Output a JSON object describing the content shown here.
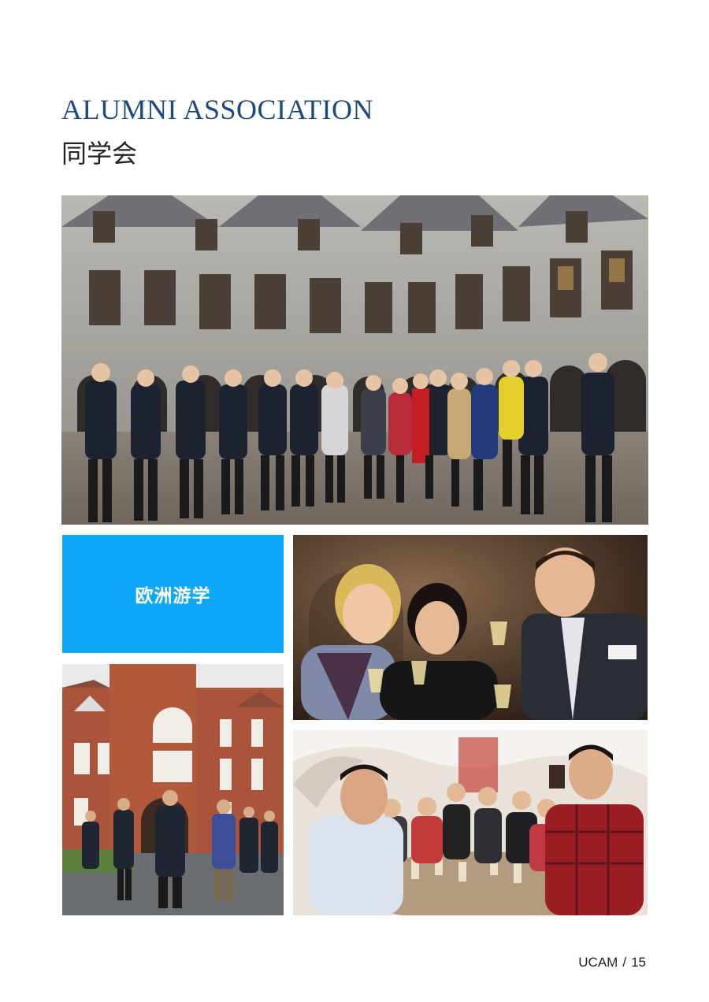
{
  "header": {
    "title_en": "ALUMNI ASSOCIATION",
    "title_zh": "同学会"
  },
  "caption_block": {
    "label": "欧洲游学",
    "color": "#0fa7f7"
  },
  "photos": [
    {
      "subject": "group photo in courtyard of gothic stone palace"
    },
    {
      "subject": "three people raising champagne glasses in a toast"
    },
    {
      "subject": "group standing in front of red brick gothic building"
    },
    {
      "subject": "group toasting around dinner table in vaulted cellar"
    }
  ],
  "footer": {
    "brand": "UCAM",
    "separator": "/",
    "page_number": "15"
  },
  "colors": {
    "title": "#1d4a7a",
    "text": "#222222"
  }
}
